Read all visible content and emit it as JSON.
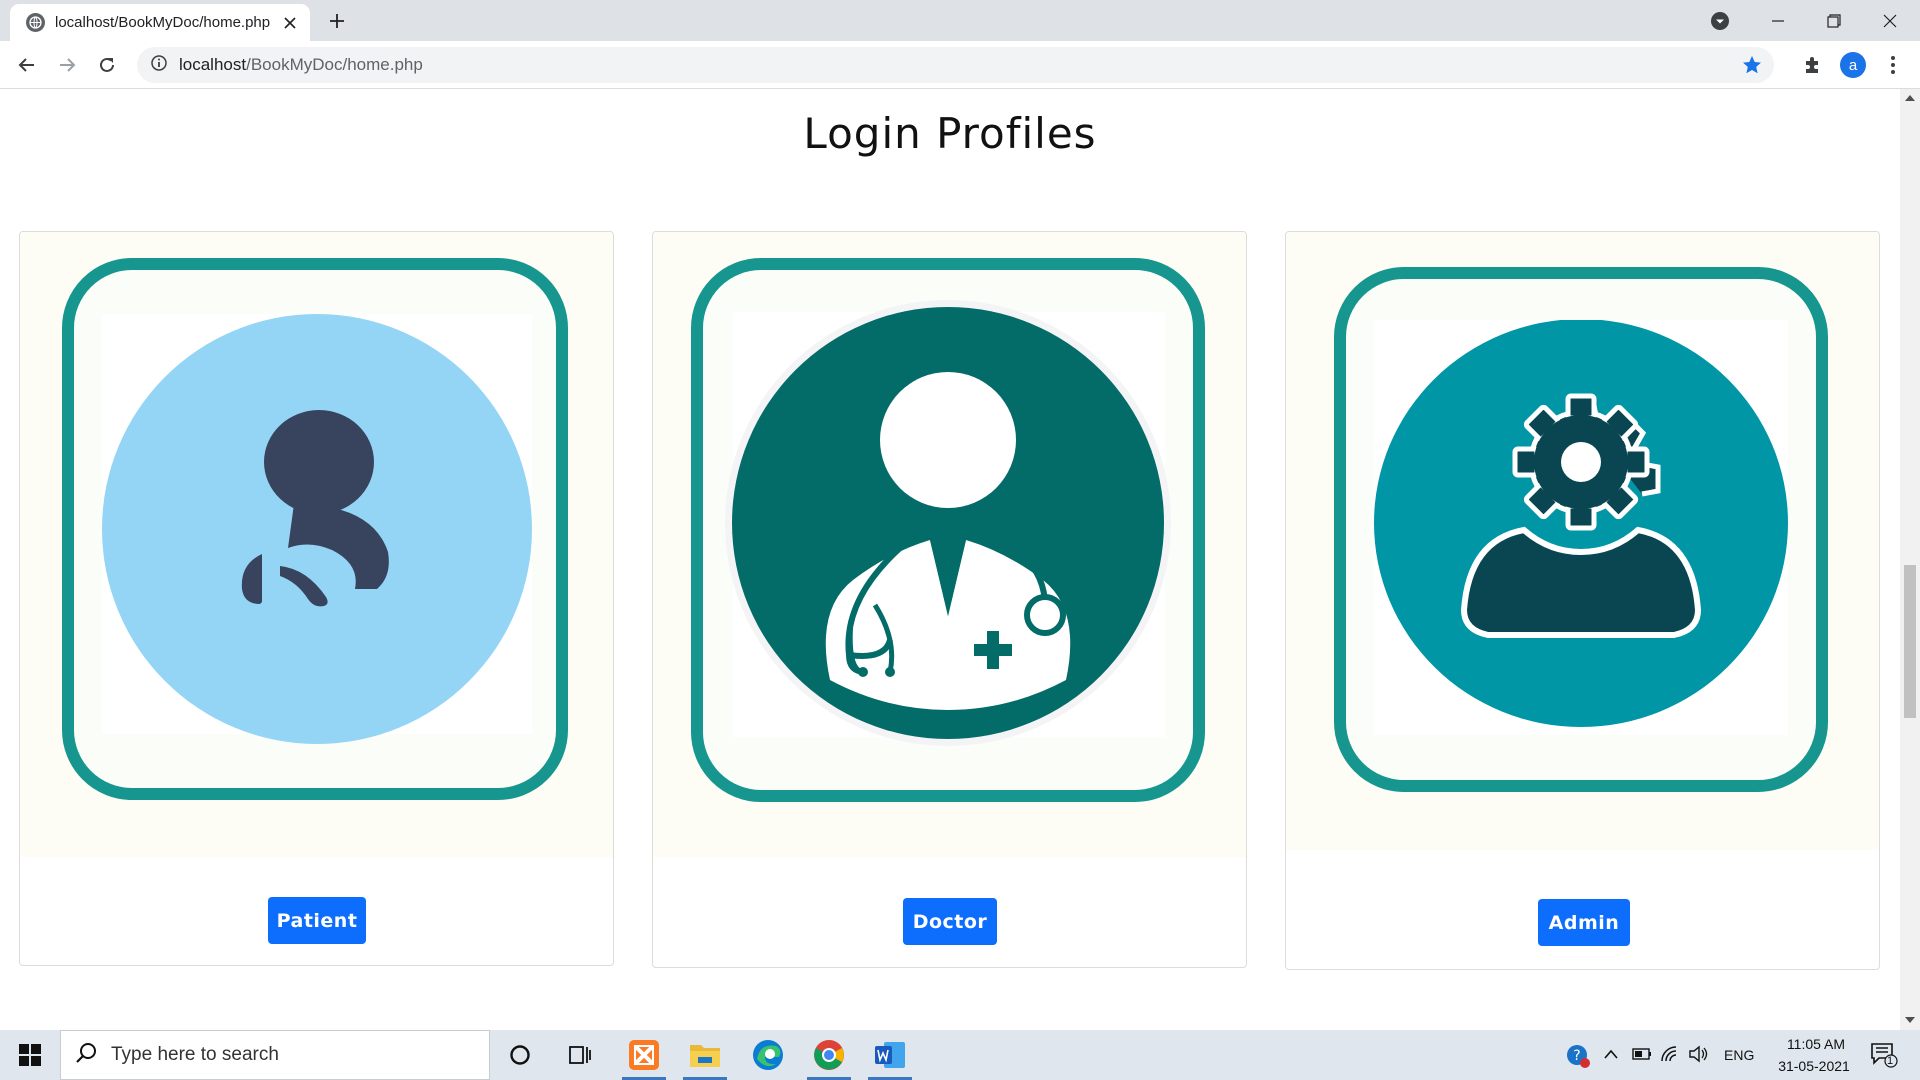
{
  "browser": {
    "tab_title": "localhost/BookMyDoc/home.php",
    "url_host": "localhost",
    "url_path": "/BookMyDoc/home.php",
    "profile_initial": "a"
  },
  "page": {
    "title": "Login Profiles",
    "cards": [
      {
        "button": "Patient",
        "circle_color": "#94d5f6",
        "icon": "patient-icon"
      },
      {
        "button": "Doctor",
        "circle_color": "#036c68",
        "icon": "doctor-icon"
      },
      {
        "button": "Admin",
        "circle_color": "#0096a6",
        "icon": "admin-gear-icon"
      }
    ],
    "accent_color": "#16968e",
    "button_color": "#0d6efd"
  },
  "taskbar": {
    "search_placeholder": "Type here to search",
    "language": "ENG",
    "time": "11:05 AM",
    "date": "31-05-2021",
    "notification_count": "1"
  }
}
